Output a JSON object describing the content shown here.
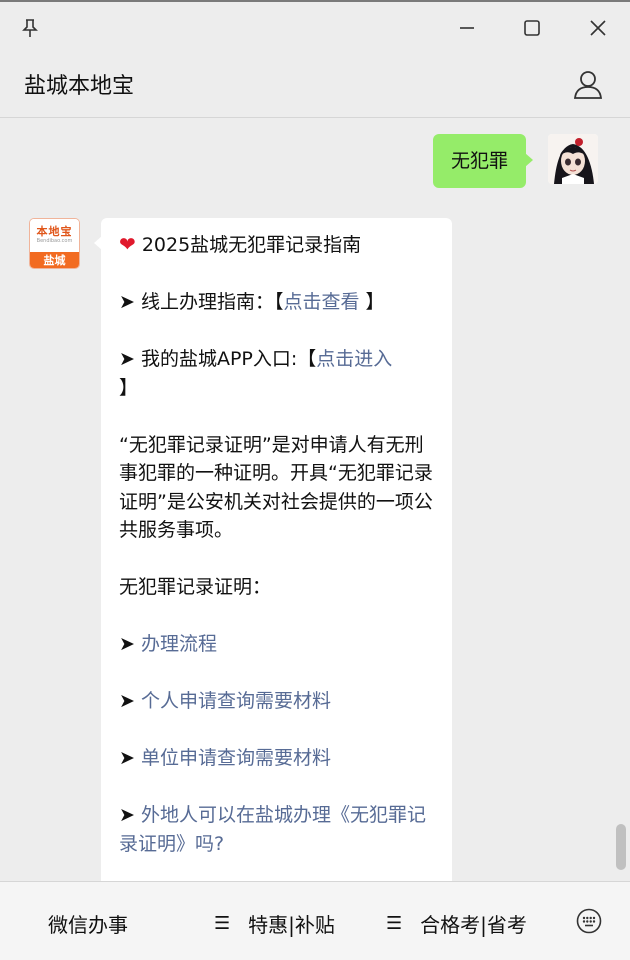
{
  "window": {
    "pin_icon": "pin-icon",
    "minimize_icon": "minimize-icon",
    "maximize_icon": "maximize-icon",
    "close_icon": "close-icon"
  },
  "header": {
    "title": "盐城本地宝",
    "user_icon": "user-icon"
  },
  "chat": {
    "user_message": "无犯罪",
    "bot_avatar": {
      "logo_text": "本地宝",
      "url_text": "Bendibao.com",
      "city_text": "盐城"
    },
    "reply": {
      "heart": "❤",
      "title": "2025盐城无犯罪记录指南",
      "line1_prefix": "➤ 线上办理指南：【",
      "line1_link": "点击查看",
      "line1_suffix": " 】",
      "line2_prefix": "➤ 我的盐城APP入口:【",
      "line2_link": "点击进入",
      "line2_suffix": "】",
      "para1": "“无犯罪记录证明”是对申请人有无刑事犯罪的一种证明。开具“无犯罪记录证明”是公安机关对社会提供的一项公共服务事项。",
      "section_label": "无犯罪记录证明：",
      "arrow": "➤ ",
      "link1": "办理流程",
      "link2": "个人申请查询需要材料",
      "link3": "单位申请查询需要材料",
      "link4": "外地人可以在盐城办理《无犯罪记录证明》吗?"
    }
  },
  "bottom_menu": {
    "item1": "微信办事",
    "item2": "特惠|补贴",
    "item3": "合格考|省考",
    "menu_glyph": "☰",
    "keyboard_icon": "keyboard-icon"
  },
  "colors": {
    "link": "#576b95",
    "user_bubble": "#95ec69",
    "background": "#ededed"
  }
}
